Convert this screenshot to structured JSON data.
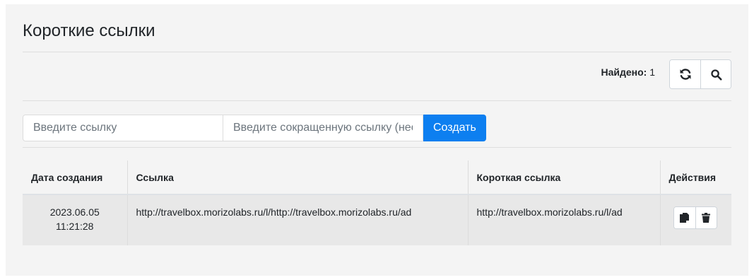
{
  "page": {
    "title": "Короткие ссылки"
  },
  "toolbar": {
    "found_label": "Найдено:",
    "found_count": "1",
    "refresh_icon": "refresh-icon",
    "search_icon": "search-icon"
  },
  "form": {
    "link_placeholder": "Введите ссылку",
    "short_placeholder": "Введите сокращенную ссылку (необязательно)",
    "create_label": "Создать"
  },
  "table": {
    "headers": [
      "Дата создания",
      "Ссылка",
      "Короткая ссылка",
      "Действия"
    ],
    "rows": [
      {
        "date": "2023.06.05",
        "time": "11:21:28",
        "link": "http://travelbox.morizolabs.ru/l/http://travelbox.morizolabs.ru/ad",
        "short": "http://travelbox.morizolabs.ru/l/ad",
        "actions": [
          "copy-icon",
          "trash-icon"
        ]
      }
    ]
  },
  "colors": {
    "primary": "#0d7ff0",
    "panel": "#f4f4f4",
    "row": "#e8e8e8"
  }
}
